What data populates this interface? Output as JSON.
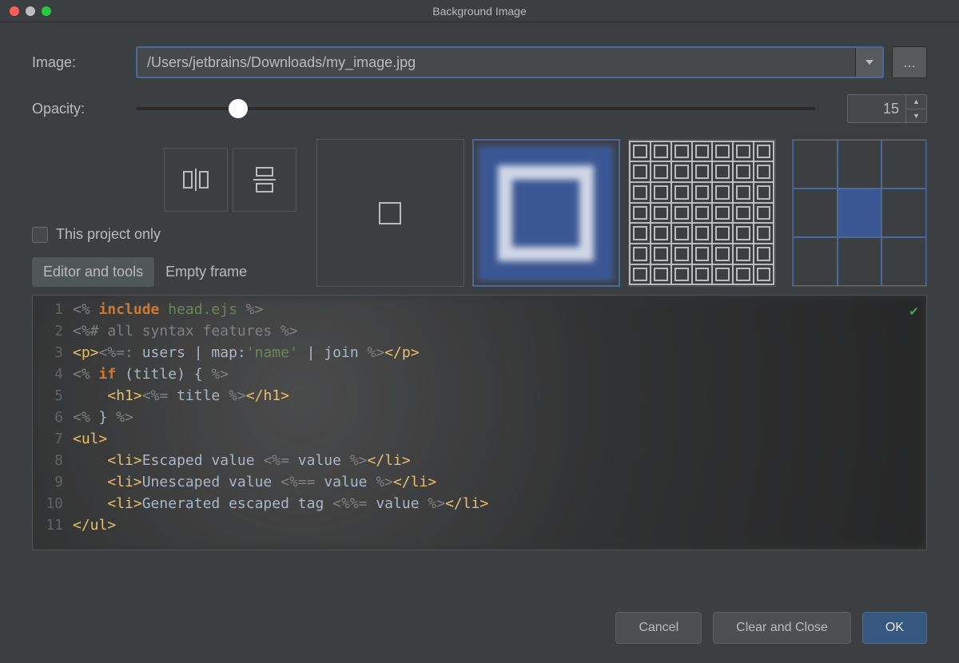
{
  "window": {
    "title": "Background Image"
  },
  "image": {
    "label": "Image:",
    "path": "/Users/jetbrains/Downloads/my_image.jpg",
    "browse": "..."
  },
  "opacity": {
    "label": "Opacity:",
    "value": "15",
    "percent": 15
  },
  "project_only": {
    "label": "This project only",
    "checked": false
  },
  "tabs": {
    "editor": "Editor and tools",
    "empty": "Empty frame",
    "active": "editor"
  },
  "code": {
    "line_numbers": [
      "1",
      "2",
      "3",
      "4",
      "5",
      "6",
      "7",
      "8",
      "9",
      "10",
      "11"
    ]
  },
  "buttons": {
    "cancel": "Cancel",
    "clear": "Clear and Close",
    "ok": "OK"
  }
}
